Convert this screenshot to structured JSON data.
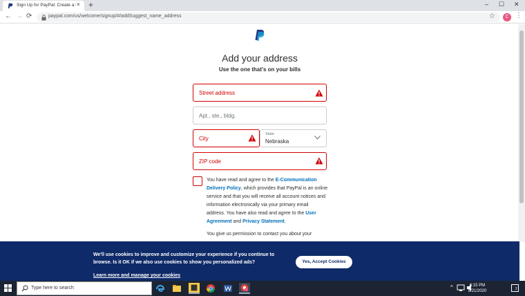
{
  "browser": {
    "tab_title": "Sign Up for PayPal: Create a Busi",
    "tab_close": "×",
    "new_tab": "+",
    "url": "paypal.com/us/welcome/signup/#/addSuggest_name_address",
    "profile_initial": "C",
    "window_controls": {
      "minimize": "–",
      "maximize": "☐",
      "close": "✕"
    },
    "nav": {
      "back": "←",
      "forward": "→",
      "reload": "⟳"
    },
    "star": "☆",
    "menu": "⋮"
  },
  "form": {
    "heading": "Add your address",
    "subheading": "Use the one that's on your bills",
    "street_placeholder": "Street address",
    "apt_placeholder": "Apt., ste., bldg.",
    "city_placeholder": "City",
    "state_label": "State",
    "state_value": "Nebraska",
    "zip_placeholder": "ZIP code",
    "error_color": "#d20000",
    "link_color": "#0070ba"
  },
  "agreement": {
    "text_1": "You have read and agree to the ",
    "link_ecomm": "E-Communication Delivery Policy",
    "text_2": ", which provides that PayPal is an online service and that you will receive all account notices and information electronically via your primary email address. You have also read and agree to the ",
    "link_user": "User Agreement",
    "text_3": " and ",
    "link_privacy": "Privacy Statement",
    "text_4": ".",
    "text_next": "You give us permission to contact you about your"
  },
  "cookie_banner": {
    "message": "We'll use cookies to improve and customize your experience if you continue to browse. Is it OK if we also use cookies to show you personalized ads?",
    "link": "Learn more and manage your cookies",
    "accept_button": "Yes, Accept Cookies",
    "background": "#0f2a68"
  },
  "taskbar": {
    "search_placeholder": "Type here to search",
    "time": "6:15 PM",
    "date": "8/21/2020",
    "tray_up": "^",
    "notification_count": "2"
  }
}
